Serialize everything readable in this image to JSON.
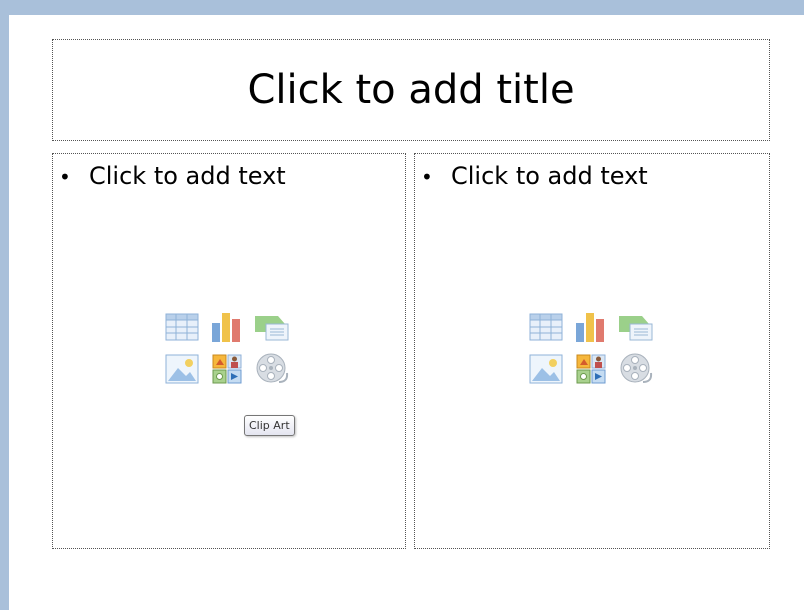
{
  "slide": {
    "title_placeholder": "Click to add title",
    "content_left": {
      "bullet_text": "Click to add text"
    },
    "content_right": {
      "bullet_text": "Click to add text"
    }
  },
  "insert_icons": [
    "table-icon",
    "chart-icon",
    "smartart-icon",
    "picture-icon",
    "clip-art-icon",
    "media-clip-icon"
  ],
  "tooltip": {
    "text": "Clip Art"
  },
  "colors": {
    "window_frame": "#a9c0da",
    "slide_background": "#ffffff",
    "placeholder_border": "#555555"
  }
}
